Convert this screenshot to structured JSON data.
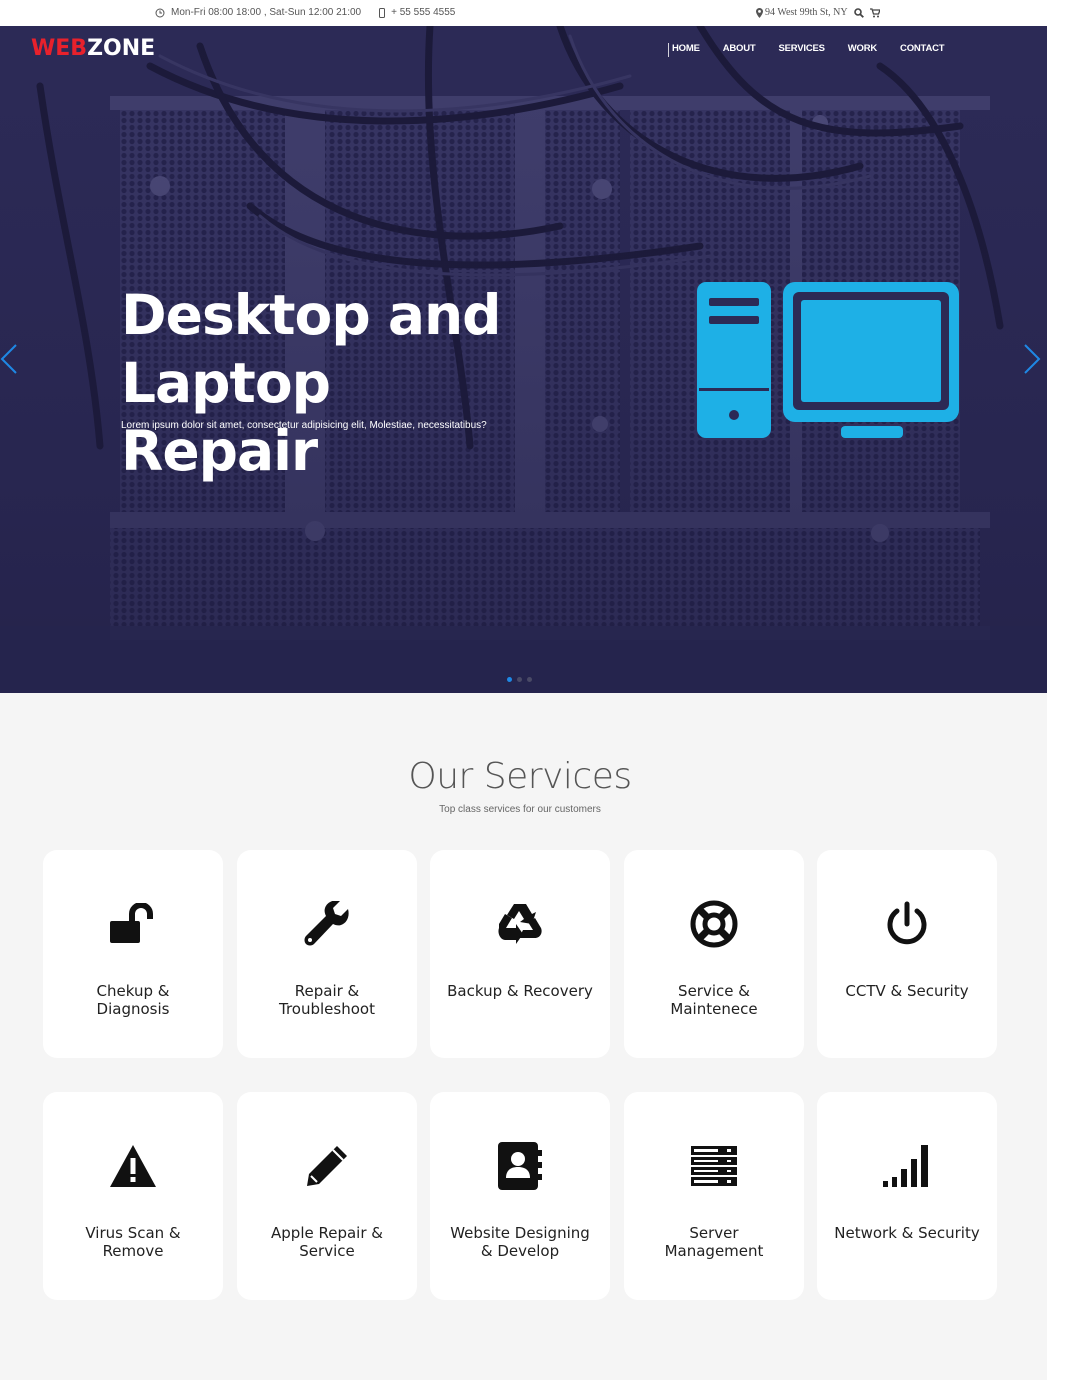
{
  "topbar": {
    "hours": "Mon-Fri 08:00 18:00 , Sat-Sun 12:00 21:00",
    "phone": "+ 55 555 4555",
    "address": "94 West 99th St, NY"
  },
  "brand": {
    "logo_part1": "WEB",
    "logo_part2": "ZONE",
    "accent": "#e8212c"
  },
  "nav": {
    "items": [
      "HOME",
      "ABOUT",
      "SERVICES",
      "WORK",
      "CONTACT"
    ]
  },
  "hero": {
    "title_line1": "Desktop and Laptop",
    "title_line2": "Repair",
    "subtitle": "Lorem ipsum dolor sit amet, consectetur adipisicing elit, Molestiae, necessitatibus?",
    "icon": "desktop-computer-icon",
    "icon_color": "#1eb0e6",
    "slides": 3,
    "active_slide": 1
  },
  "services": {
    "title": "Our Services",
    "subtitle": "Top class services for our customers",
    "items": [
      {
        "label_line1": "Chekup &",
        "label_line2": "Diagnosis",
        "icon": "unlock-icon"
      },
      {
        "label_line1": "Repair &",
        "label_line2": "Troubleshoot",
        "icon": "wrench-icon"
      },
      {
        "label_line1": "Backup & Recovery",
        "label_line2": "",
        "icon": "recycle-icon"
      },
      {
        "label_line1": "Service &",
        "label_line2": "Maintenece",
        "icon": "lifebuoy-icon"
      },
      {
        "label_line1": "CCTV & Security",
        "label_line2": "",
        "icon": "power-icon"
      },
      {
        "label_line1": "Virus Scan &",
        "label_line2": "Remove",
        "icon": "warning-icon"
      },
      {
        "label_line1": "Apple Repair &",
        "label_line2": "Service",
        "icon": "pencil-icon"
      },
      {
        "label_line1": "Website Designing",
        "label_line2": "& Develop",
        "icon": "address-book-icon"
      },
      {
        "label_line1": "Server",
        "label_line2": "Management",
        "icon": "server-icon"
      },
      {
        "label_line1": "Network & Security",
        "label_line2": "",
        "icon": "signal-icon"
      }
    ]
  }
}
